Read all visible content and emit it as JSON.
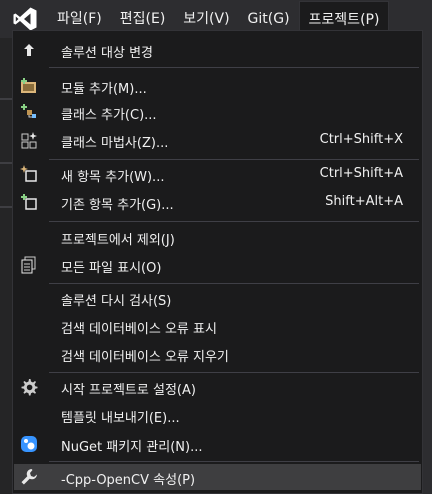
{
  "menubar": {
    "logo": "visual-studio-logo",
    "menus": [
      "파일(F)",
      "편집(E)",
      "보기(V)",
      "Git(G)",
      "프로젝트(P)"
    ]
  },
  "menu_items": [
    {
      "label": "솔루션 대상 변경",
      "shortcut": "",
      "icon": "up-arrow-icon"
    },
    {
      "label": "모듈 추가(M)...",
      "shortcut": "",
      "icon": "add-module-icon"
    },
    {
      "label": "클래스 추가(C)...",
      "shortcut": "",
      "icon": "add-class-icon"
    },
    {
      "label": "클래스 마법사(Z)...",
      "shortcut": "Ctrl+Shift+X",
      "icon": "class-wizard-icon"
    },
    {
      "label": "새 항목 추가(W)...",
      "shortcut": "Ctrl+Shift+A",
      "icon": "new-item-icon"
    },
    {
      "label": "기존 항목 추가(G)...",
      "shortcut": "Shift+Alt+A",
      "icon": "existing-item-icon"
    },
    {
      "label": "프로젝트에서 제외(J)",
      "shortcut": "",
      "icon": ""
    },
    {
      "label": "모든 파일 표시(O)",
      "shortcut": "",
      "icon": "show-all-files-icon"
    },
    {
      "label": "솔루션 다시 검사(S)",
      "shortcut": "",
      "icon": ""
    },
    {
      "label": "검색 데이터베이스 오류 표시",
      "shortcut": "",
      "icon": ""
    },
    {
      "label": "검색 데이터베이스 오류 지우기",
      "shortcut": "",
      "icon": ""
    },
    {
      "label": "시작 프로젝트로 설정(A)",
      "shortcut": "",
      "icon": "gear-icon"
    },
    {
      "label": "템플릿 내보내기(E)...",
      "shortcut": "",
      "icon": ""
    },
    {
      "label": "NuGet 패키지 관리(N)...",
      "shortcut": "",
      "icon": "nuget-icon"
    },
    {
      "label": "-Cpp-OpenCV 속성(P)",
      "shortcut": "",
      "icon": "wrench-icon"
    }
  ],
  "colors": {
    "accent_purple": "#8661c5",
    "menu_background": "#1b1b1c",
    "highlight": "#3e3e40",
    "text": "#f1f1f1",
    "icon_blue": "#3794ff",
    "icon_green": "#89d185",
    "icon_gold": "#dcb67a"
  }
}
